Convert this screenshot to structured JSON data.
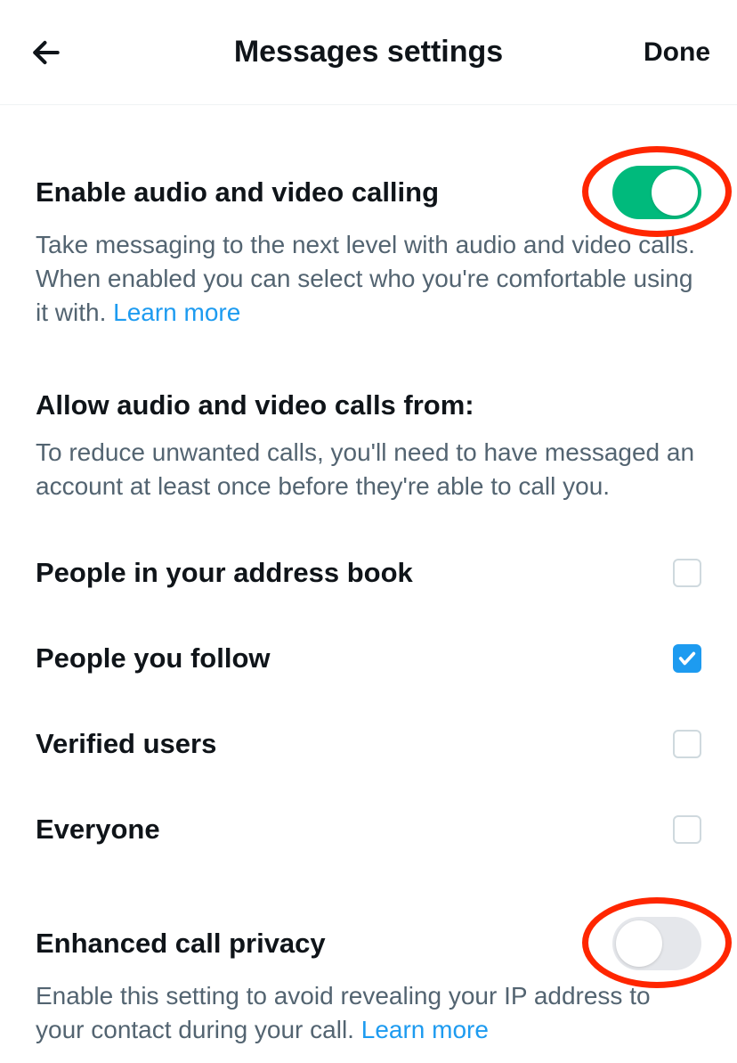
{
  "header": {
    "title": "Messages settings",
    "done": "Done"
  },
  "enableCalling": {
    "title": "Enable audio and video calling",
    "desc": "Take messaging to the next level with audio and video calls. When enabled you can select who you're comfortable using it with. ",
    "learnMore": "Learn more",
    "toggle": true
  },
  "allowFrom": {
    "heading": "Allow audio and video calls from:",
    "desc": "To reduce unwanted calls, you'll need to have messaged an account at least once before they're able to call you.",
    "options": [
      {
        "label": "People in your address book",
        "checked": false
      },
      {
        "label": "People you follow",
        "checked": true
      },
      {
        "label": "Verified users",
        "checked": false
      },
      {
        "label": "Everyone",
        "checked": false
      }
    ]
  },
  "enhancedPrivacy": {
    "title": "Enhanced call privacy",
    "desc": "Enable this setting to avoid revealing your IP address to your contact during your call. ",
    "learnMore": "Learn more",
    "toggle": false
  }
}
